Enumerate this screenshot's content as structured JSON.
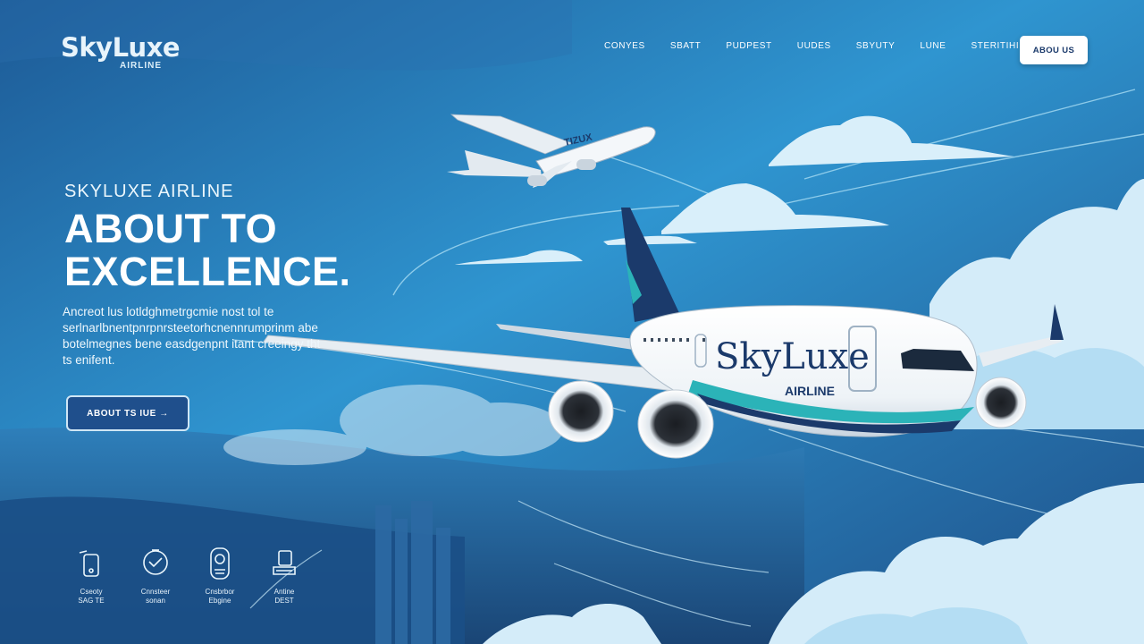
{
  "brand": {
    "name": "SkyLuxe",
    "subtitle": "AIRLINE"
  },
  "nav": {
    "items": [
      "CONYES",
      "SBATT",
      "PUDPEST",
      "UUDES",
      "SBYUTY",
      "LUNE",
      "STERITIHING"
    ],
    "cta_label": "ABOU US"
  },
  "hero": {
    "eyebrow": "SKYLUXE AIRLINE",
    "title_line1": "ABOUT TO",
    "title_line2": "EXCELLENCE.",
    "description": "Ancreot lus lotldghmetrgcmie nost tol te serlnarlbnentpnrpnrsteetorhcnennrumprinm abe botelmegnes bene easdgenpnt itant creeingy tht ts enifent.",
    "button_label": "ABOUT TS IUE →"
  },
  "features": [
    {
      "icon": "phone-icon",
      "label_line1": "Cseoty",
      "label_line2": "SAG TE"
    },
    {
      "icon": "safety-badge-icon",
      "label_line1": "Cnnsteer",
      "label_line2": "sonan"
    },
    {
      "icon": "passport-icon",
      "label_line1": "Cnsbrbor",
      "label_line2": "Ebgine"
    },
    {
      "icon": "seat-icon",
      "label_line1": "Antine",
      "label_line2": "DEST"
    }
  ],
  "plane": {
    "livery_name": "SkyLuxe",
    "livery_sub": "AIRLINE",
    "small_plane_text": "TIZUX"
  },
  "colors": {
    "navy": "#1b3a6b",
    "sky_blue": "#3aa9dd",
    "deep_blue": "#1f5f9c",
    "teal_stripe": "#2bb3b8",
    "cloud": "#dff1fb"
  }
}
